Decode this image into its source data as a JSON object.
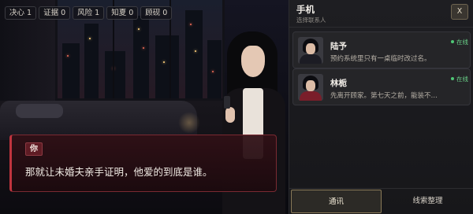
{
  "stats": [
    {
      "label": "决心",
      "value": "1"
    },
    {
      "label": "证据",
      "value": "0"
    },
    {
      "label": "风险",
      "value": "1"
    },
    {
      "label": "知夏",
      "value": "0"
    },
    {
      "label": "顾砚",
      "value": "0"
    }
  ],
  "dialogue": {
    "speaker": "你",
    "text": "那就让未婚夫亲手证明，他爱的到底是谁。"
  },
  "phone": {
    "title": "手机",
    "subtitle": "选择联系人",
    "close_label": "X",
    "contacts": [
      {
        "name": "陆予",
        "preview": "预约系统里只有一桌临时改过名。",
        "status": "在线",
        "avatar_icon": "male-avatar-icon"
      },
      {
        "name": "林栀",
        "preview": "先离开顾家。第七天之前，能装不…",
        "status": "在线",
        "avatar_icon": "female-avatar-icon"
      }
    ],
    "tabs": [
      {
        "label": "通讯",
        "active": true
      },
      {
        "label": "线索整理",
        "active": false
      }
    ]
  },
  "colors": {
    "accent_red": "#c0343e",
    "online_green": "#4ec776",
    "active_tab_border": "#8a7a58"
  }
}
